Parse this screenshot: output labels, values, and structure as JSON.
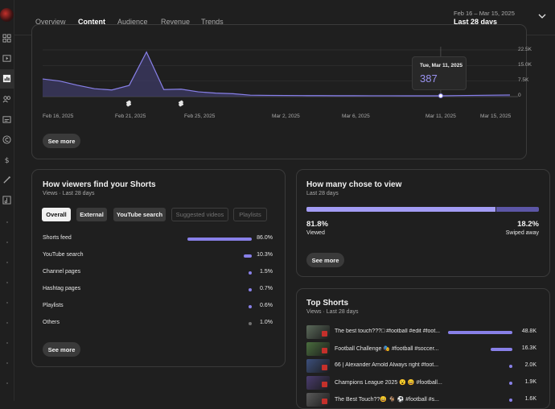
{
  "nav": {
    "tabs": [
      {
        "label": "Overview"
      },
      {
        "label": "Content"
      },
      {
        "label": "Audience"
      },
      {
        "label": "Revenue"
      },
      {
        "label": "Trends"
      }
    ],
    "active_tab": "Content",
    "date_range_small": "Feb 16 – Mar 15, 2025",
    "date_range_label": "Last 28 days"
  },
  "sidebar": {
    "icons": [
      "dashboard-icon",
      "content-icon",
      "analytics-icon",
      "community-icon",
      "subtitles-icon",
      "copyright-icon",
      "earn-icon",
      "customization-icon",
      "audio-library-icon"
    ]
  },
  "views_chart": {
    "y_ticks": [
      "22.5K",
      "15.0K",
      "7.5K",
      "0"
    ],
    "x_ticks": [
      "Feb 16, 2025",
      "Feb 21, 2025",
      "Feb 25, 2025",
      "Mar 2, 2025",
      "Mar 6, 2025",
      "Mar 11, 2025",
      "Mar 15, 2025"
    ],
    "tooltip_date": "Tue, Mar 11, 2025",
    "tooltip_value": "387",
    "see_more": "See more",
    "accent_color": "#8880e8"
  },
  "chart_data": {
    "type": "area",
    "x": [
      "Feb 16",
      "Feb 17",
      "Feb 18",
      "Feb 19",
      "Feb 20",
      "Feb 21",
      "Feb 22",
      "Feb 23",
      "Feb 24",
      "Feb 25",
      "Feb 26",
      "Feb 27",
      "Feb 28",
      "Mar 1",
      "Mar 2",
      "Mar 3",
      "Mar 4",
      "Mar 5",
      "Mar 6",
      "Mar 7",
      "Mar 8",
      "Mar 9",
      "Mar 10",
      "Mar 11",
      "Mar 12",
      "Mar 13",
      "Mar 14",
      "Mar 15"
    ],
    "values": [
      8500,
      7500,
      5500,
      3800,
      3200,
      5400,
      21500,
      3400,
      3600,
      2300,
      1700,
      1400,
      700,
      600,
      550,
      500,
      480,
      450,
      430,
      420,
      410,
      400,
      390,
      387,
      500,
      600,
      700,
      800
    ],
    "ylim": [
      0,
      22500
    ],
    "grid": true
  },
  "find_shorts": {
    "title": "How viewers find your Shorts",
    "subtitle": "Views · Last 28 days",
    "chips": [
      {
        "label": "Overall",
        "state": "selected"
      },
      {
        "label": "External",
        "state": "on"
      },
      {
        "label": "YouTube search",
        "state": "on"
      },
      {
        "label": "Suggested videos",
        "state": "off"
      },
      {
        "label": "Playlists",
        "state": "off"
      }
    ],
    "rows": [
      {
        "label": "Shorts feed",
        "value": "86.0%",
        "share": 0.86,
        "dot_color": "#8880e8"
      },
      {
        "label": "YouTube search",
        "value": "10.3%",
        "share": 0.103,
        "dot_color": "#8880e8"
      },
      {
        "label": "Channel pages",
        "value": "1.5%",
        "share": 0.015,
        "dot_color": "#8880e8"
      },
      {
        "label": "Hashtag pages",
        "value": "0.7%",
        "share": 0.007,
        "dot_color": "#8880e8"
      },
      {
        "label": "Playlists",
        "value": "0.6%",
        "share": 0.006,
        "dot_color": "#8880e8"
      },
      {
        "label": "Others",
        "value": "1.0%",
        "share": 0.01,
        "dot_color": "#717171"
      }
    ],
    "see_more": "See more"
  },
  "chose_to_view": {
    "title": "How many chose to view",
    "subtitle": "Last 28 days",
    "viewed_pct": "81.8%",
    "viewed_label": "Viewed",
    "viewed_share": 0.818,
    "swiped_pct": "18.2%",
    "swiped_label": "Swiped away",
    "see_more": "See more"
  },
  "top_shorts": {
    "title": "Top Shorts",
    "subtitle": "Views · Last 28 days",
    "rows": [
      {
        "title": "The best touch???□ #football #edit #foot...",
        "value": "48.8K",
        "share": 1.0,
        "thumb": "#5b6a5a"
      },
      {
        "title": "Football Challenge 🎭 #football #soccer...",
        "value": "16.3K",
        "share": 0.334,
        "thumb": "#4a6e3e"
      },
      {
        "title": "66 | Alexander Arnold Always right #foot...",
        "value": "2.0K",
        "share": 0.041,
        "thumb": "#3c4f7c"
      },
      {
        "title": "Champions League 2025 😮 😄 #football...",
        "value": "1.9K",
        "share": 0.039,
        "thumb": "#4a3c6e"
      },
      {
        "title": "The Best Touch??😄 🐐 ⚽ #football #s...",
        "value": "1.6K",
        "share": 0.033,
        "thumb": "#5a5a5a"
      }
    ]
  }
}
